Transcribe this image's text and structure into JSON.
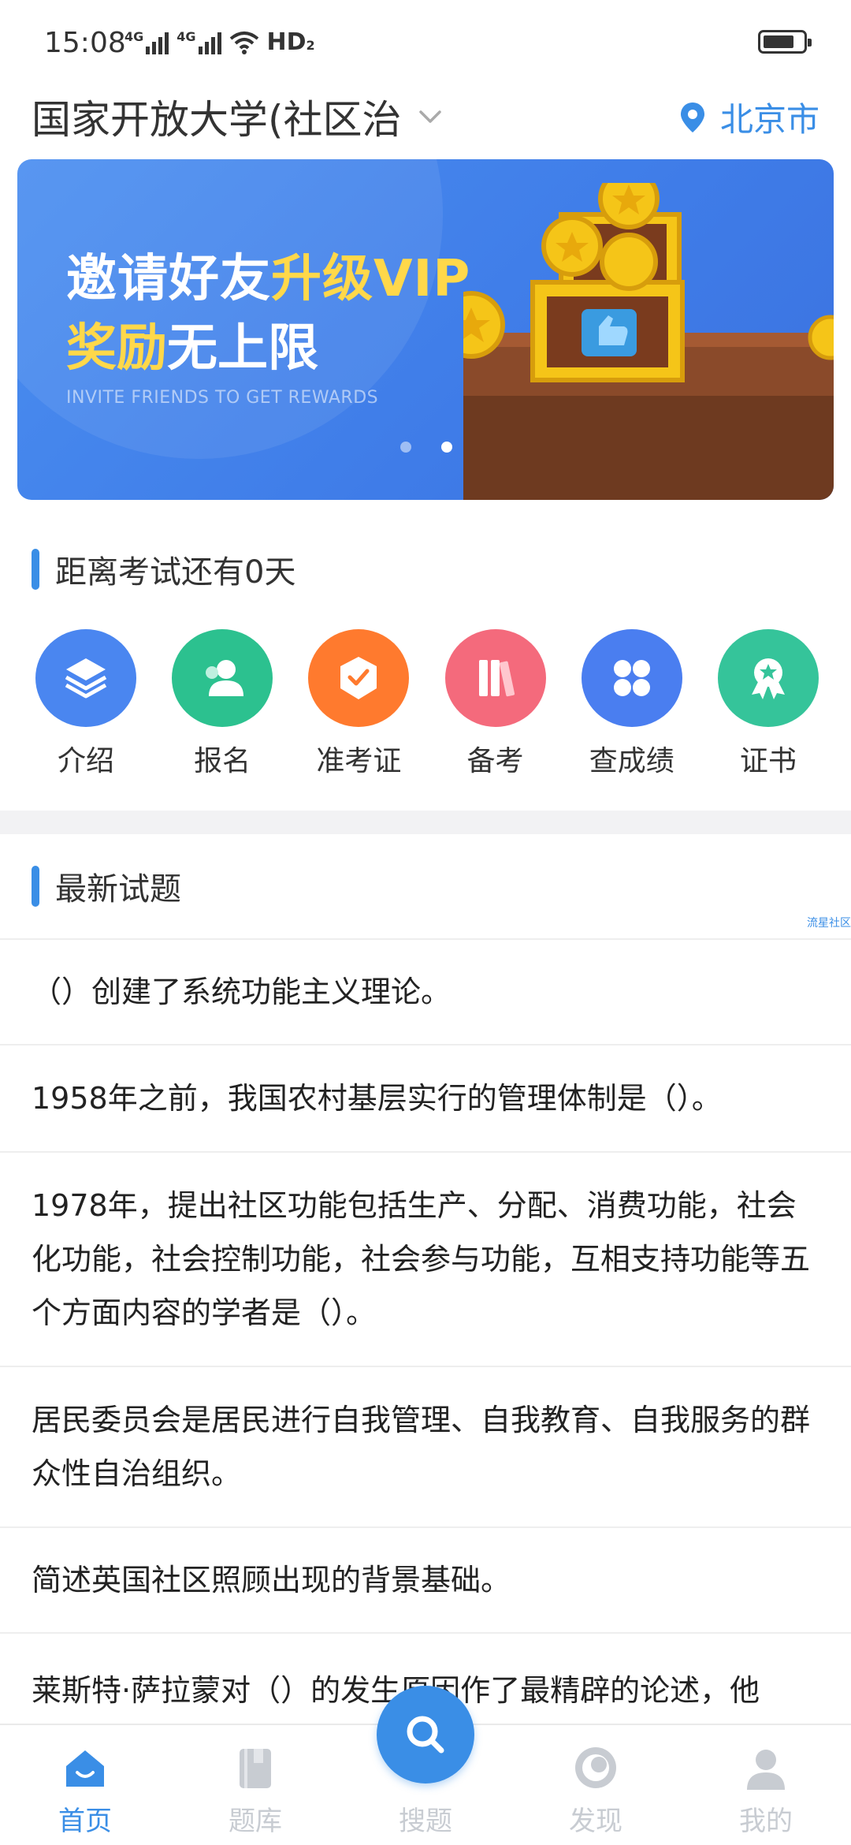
{
  "status_bar": {
    "time": "15:08",
    "network1": "4G",
    "network2": "4G",
    "hd": "HD",
    "hd_sub": "2"
  },
  "header": {
    "school": "国家开放大学(社区治",
    "city": "北京市"
  },
  "banner": {
    "line1_white": "邀请好友",
    "line1_yellow": "升级VIP",
    "line2_yellow": "奖励",
    "line2_white": "无上限",
    "subtitle": "INVITE FRIENDS TO GET REWARDS",
    "active_slide": 2,
    "slide_count": 2
  },
  "countdown": {
    "text": "距离考试还有0天"
  },
  "shortcuts": [
    {
      "label": "介绍",
      "icon": "layers-icon",
      "color": "#4a86f0"
    },
    {
      "label": "报名",
      "icon": "user-icon",
      "color": "#2cc18f"
    },
    {
      "label": "准考证",
      "icon": "check-badge-icon",
      "color": "#ff7a2e"
    },
    {
      "label": "备考",
      "icon": "books-icon",
      "color": "#f46a7c"
    },
    {
      "label": "查成绩",
      "icon": "grid-dots-icon",
      "color": "#4a7ef0"
    },
    {
      "label": "证书",
      "icon": "award-icon",
      "color": "#35c49a"
    }
  ],
  "latest": {
    "title": "最新试题",
    "side_tag": "流星社区"
  },
  "questions": [
    "（）创建了系统功能主义理论。",
    "1958年之前，我国农村基层实行的管理体制是（）。",
    "1978年，提出社区功能包括生产、分配、消费功能，社会化功能，社会控制功能，社会参与功能，互相支持功能等五个方面内容的学者是（）。",
    "居民委员会是居民进行自我管理、自我教育、自我服务的群众性自治组织。",
    "简述英国社区照顾出现的背景基础。",
    "莱斯特·萨拉蒙对（）的发生原因作了最精辟的论述，他"
  ],
  "tabs": [
    {
      "label": "首页",
      "icon": "home-icon",
      "active": true
    },
    {
      "label": "题库",
      "icon": "book-icon",
      "active": false
    },
    {
      "label": "搜题",
      "icon": "search-icon",
      "active": false
    },
    {
      "label": "发现",
      "icon": "compass-icon",
      "active": false
    },
    {
      "label": "我的",
      "icon": "profile-icon",
      "active": false
    }
  ],
  "colors": {
    "accent": "#3a8ee6",
    "banner": "#3f7ce8",
    "highlight": "#ffd84a"
  }
}
